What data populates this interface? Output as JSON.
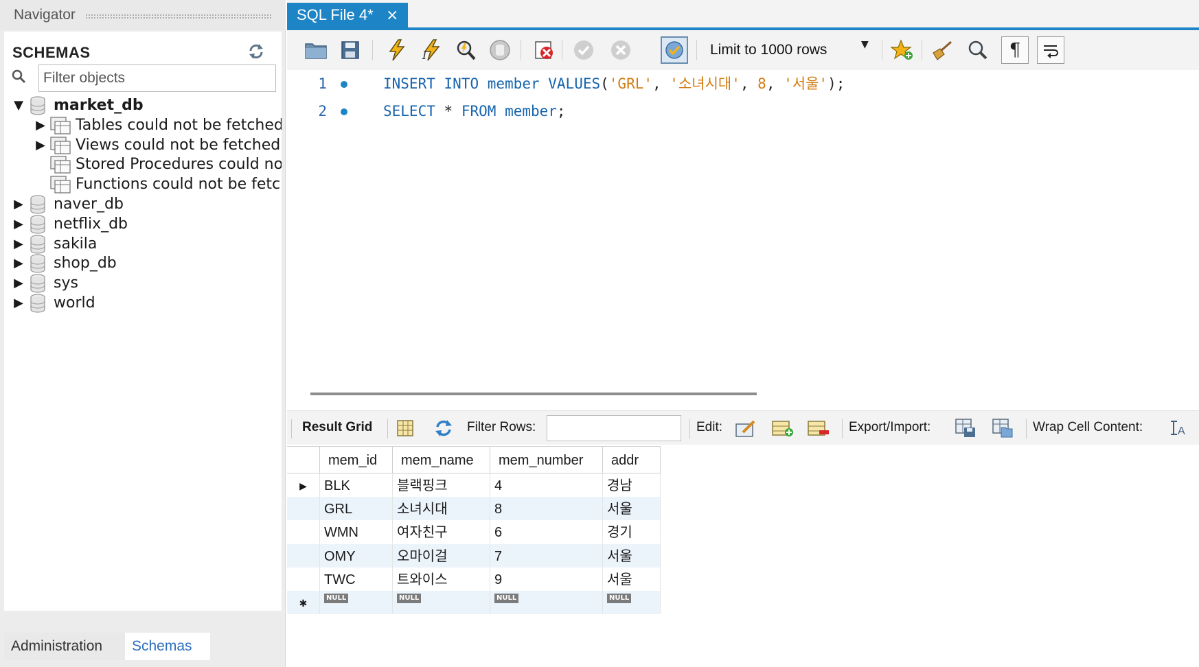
{
  "navigator": {
    "title": "Navigator",
    "schemas_title": "SCHEMAS",
    "filter_placeholder": "Filter objects",
    "schemas": [
      {
        "name": "market_db",
        "expanded": true,
        "children": [
          "Tables could not be fetched",
          "Views could not be fetched",
          "Stored Procedures could not",
          "Functions could not be fetch"
        ]
      },
      {
        "name": "naver_db"
      },
      {
        "name": "netflix_db"
      },
      {
        "name": "sakila"
      },
      {
        "name": "shop_db"
      },
      {
        "name": "sys"
      },
      {
        "name": "world"
      }
    ],
    "tabs": {
      "administration": "Administration",
      "schemas": "Schemas"
    }
  },
  "editor": {
    "tab_label": "SQL File 4*",
    "tab_close": "×",
    "limit_label": "Limit to 1000 rows",
    "line_numbers": [
      "1",
      "2"
    ],
    "sql": {
      "line1": {
        "insert": "INSERT",
        "into": "INTO",
        "table": "member",
        "values": "VALUES",
        "open": "(",
        "v1": "'GRL'",
        "comma": ", ",
        "v2": "'소녀시대'",
        "v3": "8",
        "v4": "'서울'",
        "close": ");"
      },
      "line2": {
        "select": "SELECT",
        "star": "*",
        "from": "FROM",
        "table": "member",
        "semi": ";"
      }
    }
  },
  "result": {
    "result_grid_label": "Result Grid",
    "filter_rows_label": "Filter Rows:",
    "edit_label": "Edit:",
    "export_label": "Export/Import:",
    "wrap_label": "Wrap Cell Content:",
    "columns": [
      "mem_id",
      "mem_name",
      "mem_number",
      "addr"
    ],
    "rows": [
      [
        "BLK",
        "블랙핑크",
        "4",
        "경남"
      ],
      [
        "GRL",
        "소녀시대",
        "8",
        "서울"
      ],
      [
        "WMN",
        "여자친구",
        "6",
        "경기"
      ],
      [
        "OMY",
        "오마이걸",
        "7",
        "서울"
      ],
      [
        "TWC",
        "트와이스",
        "9",
        "서울"
      ]
    ],
    "null_label": "NULL"
  },
  "colors": {
    "accent": "#1d85c6",
    "keyword": "#1764ad",
    "string": "#d37b12"
  }
}
